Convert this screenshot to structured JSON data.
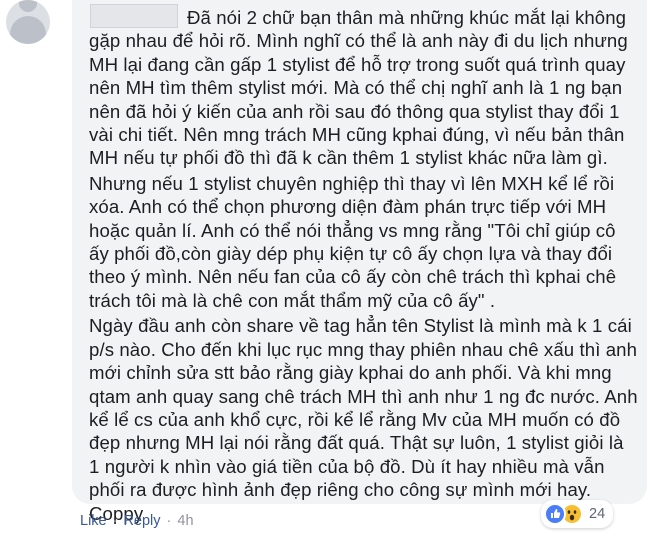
{
  "comment": {
    "paragraphs": [
      "Đã nói 2 chữ bạn thân mà những khúc mắt lại không gặp nhau để hỏi rõ. Mình nghĩ có thể là anh này đi du lịch nhưng MH lại đang cần gấp 1 stylist để hỗ trợ trong suốt quá trình quay nên MH tìm thêm stylist mới. Mà có thể chị nghĩ anh là 1 ng bạn nên đã hỏi ý kiến của anh rồi sau đó thông qua stylist thay đổi 1 vài chi tiết. Nên mng trách MH cũng kphai đúng, vì nếu bản thân MH nếu tự phối đồ thì đã k cần thêm 1 stylist khác nữa làm gì.",
      "Nhưng nếu 1 stylist chuyên nghiệp thì thay vì lên MXH kể lể rồi xóa. Anh có thể chọn phương diện đàm phán trực tiếp với MH hoặc quản lí. Anh có thể nói thẳng vs mng rằng \"Tôi chỉ giúp cô ấy phối đồ,còn giày dép phụ kiện tự cô ấy chọn lựa và thay đổi theo ý mình. Nên nếu fan của cô ấy còn chê trách thì kphai chê trách tôi mà là chê con mắt thẩm mỹ của cô ấy\" .",
      "Ngày đầu anh còn share về tag hẳn tên Stylist là mình mà k 1 cái p/s nào. Cho đến khi lục rục mng thay phiên nhau chê xấu thì anh mới chỉnh sửa stt bảo rằng giày kphai do anh phối. Và khi mng qtam anh quay sang chê trách MH thì anh như 1 ng đc nước. Anh kể lể cs của anh khổ cực, rồi kể lể rằng Mv của MH muốn có đồ đẹp nhưng MH lại nói rằng đất quá. Thật sự luôn, 1 stylist giỏi là 1 người k nhìn vào giá tiền của bộ đồ. Dù ít hay nhiều mà vẫn phối ra được hình ảnh đẹp riêng cho công sự mình mới hay. Coppy"
    ]
  },
  "actions": {
    "like_label": "Like",
    "separator": "·",
    "reply_label": "Reply",
    "time": "4h"
  },
  "reactions": {
    "count": "24",
    "icons": [
      "like-icon",
      "wow-icon"
    ],
    "colors": {
      "like": "#4a7ef7",
      "wow": "#f7c033"
    }
  }
}
